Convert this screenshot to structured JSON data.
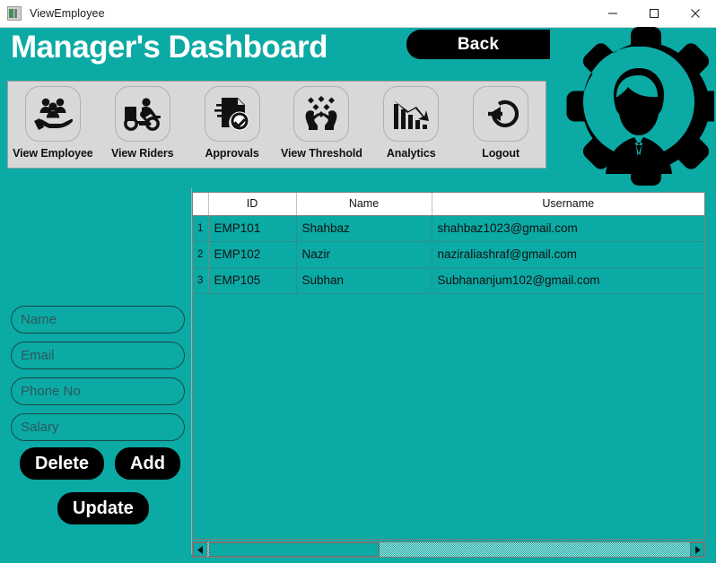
{
  "window": {
    "title": "ViewEmployee",
    "icon": "app-window-icon",
    "controls": {
      "minimize": "minimize-icon",
      "maximize": "maximize-icon",
      "close": "close-icon"
    }
  },
  "header": {
    "title": "Manager's Dashboard",
    "back_label": "Back",
    "logo": "gear-user-logo"
  },
  "toolbar": {
    "items": [
      {
        "label": "View Employee",
        "icon": "people-in-hand-icon"
      },
      {
        "label": "View Riders",
        "icon": "delivery-scooter-icon"
      },
      {
        "label": "Approvals",
        "icon": "document-check-icon"
      },
      {
        "label": "View Threshold",
        "icon": "hands-coins-icon"
      },
      {
        "label": "Analytics",
        "icon": "bar-chart-down-arrow-icon"
      },
      {
        "label": "Logout",
        "icon": "logout-arrow-icon"
      }
    ]
  },
  "form": {
    "fields": [
      {
        "name": "name",
        "value": "",
        "placeholder": "Name"
      },
      {
        "name": "email",
        "value": "",
        "placeholder": "Email"
      },
      {
        "name": "phone",
        "value": "",
        "placeholder": "Phone No"
      },
      {
        "name": "salary",
        "value": "",
        "placeholder": "Salary"
      }
    ],
    "buttons": {
      "delete": "Delete",
      "add": "Add",
      "update": "Update"
    }
  },
  "table": {
    "columns": [
      "",
      "ID",
      "Name",
      "Username"
    ],
    "rows": [
      {
        "index": "1",
        "id": "EMP101",
        "name": "Shahbaz",
        "username": "shahbaz1023@gmail.com"
      },
      {
        "index": "2",
        "id": "EMP102",
        "name": "Nazir",
        "username": "naziraliashraf@gmail.com"
      },
      {
        "index": "3",
        "id": "EMP105",
        "name": "Subhan",
        "username": "Subhananjum102@gmail.com"
      }
    ]
  },
  "scrollbar": {
    "left_arrow": "scroll-left-icon",
    "right_arrow": "scroll-right-icon"
  },
  "colors": {
    "background": "#0BAAA5",
    "toolbar_panel": "#D8D8D8",
    "button": "#000000",
    "header_text": "#FFFFFF"
  }
}
